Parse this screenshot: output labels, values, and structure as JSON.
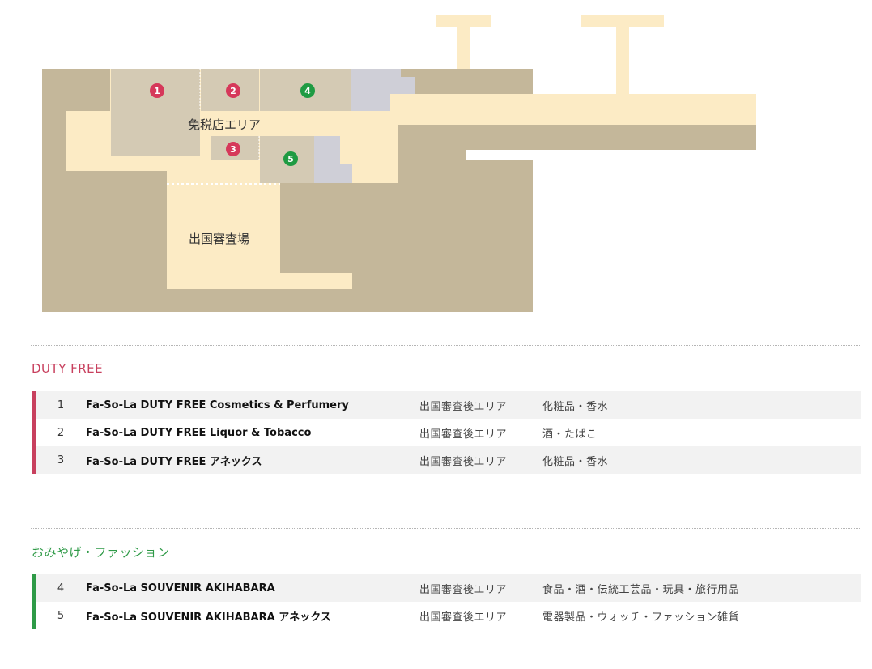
{
  "map": {
    "area_duty_free_label": "免税店エリア",
    "area_departure_label": "出国審査場",
    "markers": [
      {
        "num": "1",
        "kind": "duty-free"
      },
      {
        "num": "2",
        "kind": "duty-free"
      },
      {
        "num": "3",
        "kind": "duty-free"
      },
      {
        "num": "4",
        "kind": "souvenir"
      },
      {
        "num": "5",
        "kind": "souvenir"
      }
    ]
  },
  "colors": {
    "duty_free_accent": "#c8405e",
    "souvenir_accent": "#2e9a47",
    "marker_red": "#d6385a",
    "marker_green": "#1f9b43"
  },
  "sections": {
    "duty_free": {
      "title": "DUTY FREE",
      "shops": [
        {
          "num": "1",
          "name": "Fa-So-La DUTY FREE Cosmetics & Perfumery",
          "area": "出国審査後エリア",
          "category": "化粧品・香水"
        },
        {
          "num": "2",
          "name": "Fa-So-La DUTY FREE Liquor & Tobacco",
          "area": "出国審査後エリア",
          "category": "酒・たばこ"
        },
        {
          "num": "3",
          "name": "Fa-So-La DUTY FREE アネックス",
          "area": "出国審査後エリア",
          "category": "化粧品・香水"
        }
      ]
    },
    "souvenir": {
      "title": "おみやげ・ファッション",
      "shops": [
        {
          "num": "4",
          "name": "Fa-So-La SOUVENIR AKIHABARA",
          "area": "出国審査後エリア",
          "category": "食品・酒・伝統工芸品・玩具・旅行用品"
        },
        {
          "num": "5",
          "name": "Fa-So-La SOUVENIR AKIHABARA アネックス",
          "area": "出国審査後エリア",
          "category": "電器製品・ウォッチ・ファッション雑貨"
        }
      ]
    }
  }
}
